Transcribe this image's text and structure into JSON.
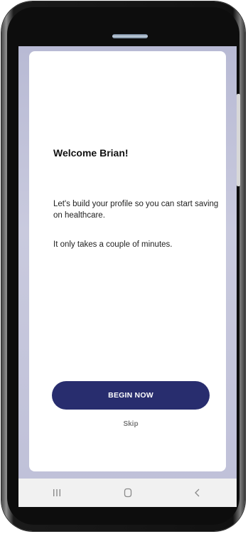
{
  "welcome": {
    "title": "Welcome Brian!",
    "intro": "Let's build your profile so you can start saving on healthcare.",
    "duration_note": "It only takes a couple of minutes."
  },
  "actions": {
    "begin_label": "BEGIN NOW",
    "skip_label": "Skip"
  },
  "navbar": {
    "recent_icon": "recent-apps-icon",
    "home_icon": "home-icon",
    "back_icon": "back-icon"
  },
  "colors": {
    "primary_button": "#282d6e",
    "backdrop": "#bfc0d8",
    "skip_text": "#7a7a7a"
  }
}
